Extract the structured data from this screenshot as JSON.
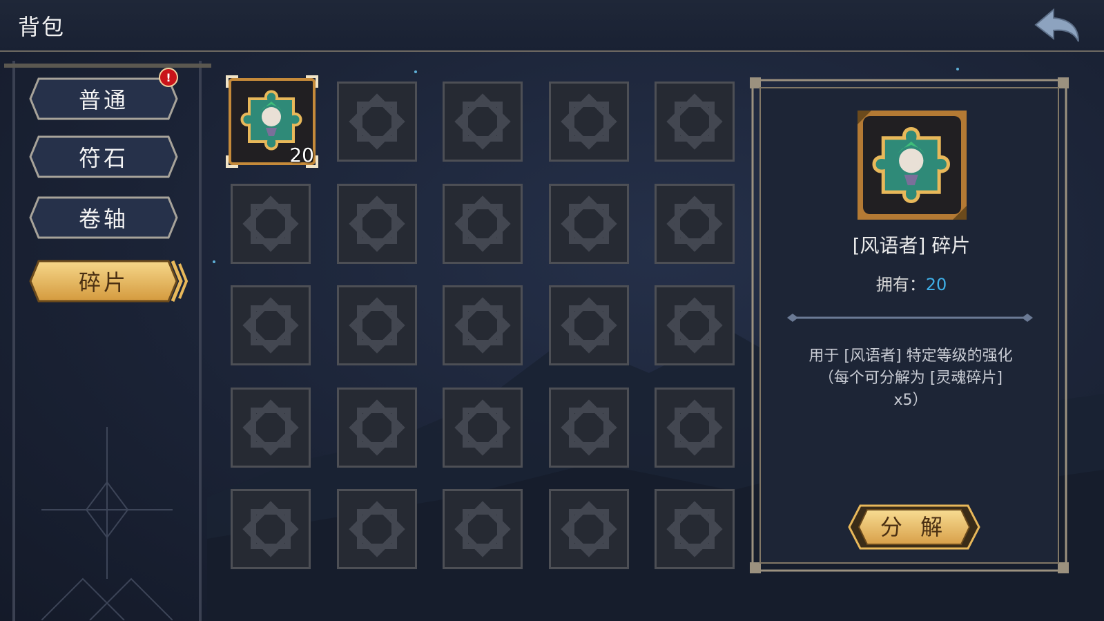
{
  "header": {
    "title": "背包",
    "back_icon": "back-arrow-icon"
  },
  "sidebar": {
    "tabs": [
      {
        "label": "普通",
        "active": false
      },
      {
        "label": "符石",
        "active": false
      },
      {
        "label": "卷轴",
        "active": false
      },
      {
        "label": "碎片",
        "active": true
      }
    ],
    "badge": "!"
  },
  "inventory": {
    "columns": 5,
    "rows": 5,
    "slots": [
      {
        "item": "风语者碎片",
        "count": "20",
        "selected": true
      }
    ]
  },
  "detail": {
    "name": "[风语者] 碎片",
    "owned_label": "拥有：",
    "owned_count": "20",
    "description_lines": [
      "用于 [风语者] 特定等级的强化",
      "（每个可分解为 [灵魂碎片]",
      "x5）"
    ],
    "action_label": "分 解"
  },
  "colors": {
    "gold": "#e8b85a",
    "gold_dark": "#a8742a",
    "accent_blue": "#3fb0e8",
    "tab_dark": "#26314a"
  }
}
